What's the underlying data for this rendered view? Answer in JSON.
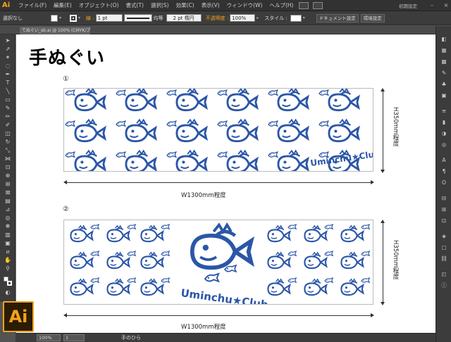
{
  "app": {
    "logo_small": "Ai",
    "logo_large": "Ai",
    "menu": [
      "ファイル(F)",
      "編集(E)",
      "オブジェクト(O)",
      "書式(T)",
      "選択(S)",
      "効果(C)",
      "表示(V)",
      "ウィンドウ(W)",
      "ヘルプ(H)"
    ],
    "workspace": "初期設定",
    "accent": "#f7a21b"
  },
  "control": {
    "selection": "選択なし",
    "stroke_label": "線 :",
    "stroke_weight": "1 pt",
    "stroke_profile": "均等",
    "brush": "2 pt 楕円",
    "opacity_label": "不透明度 :",
    "opacity_value": "100%",
    "style_label": "スタイル :",
    "doc_settings": "ドキュメント設定",
    "prefs": "環境設定"
  },
  "tab": {
    "title": "てぬぐい_sb.ai @ 100% (CMYK/プレビュー)"
  },
  "artboard": {
    "title": "手ぬぐい",
    "design1_label": "①",
    "design2_label": "②",
    "width_label": "W1300mm程度",
    "height_label": "H350mm程度",
    "club_text": "Uminchu★Club",
    "design_color": "#2b56a8"
  },
  "status": {
    "zoom": "100%",
    "page": "1",
    "tool_name": "手のひら"
  }
}
